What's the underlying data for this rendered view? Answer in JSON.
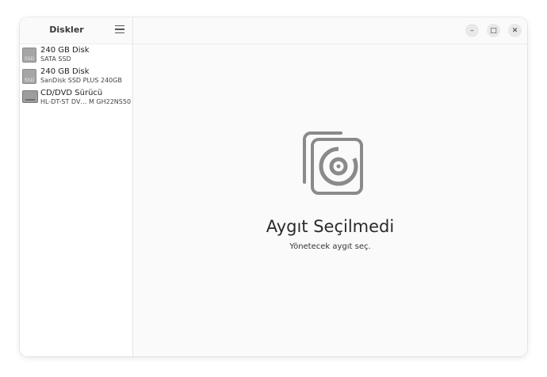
{
  "sidebar": {
    "title": "Diskler",
    "menu_icon": "hamburger-menu-icon",
    "items": [
      {
        "name": "240 GB Disk",
        "subtitle": "SATA SSD",
        "icon": "ssd-drive-icon",
        "icon_label": "SSD"
      },
      {
        "name": "240 GB Disk",
        "subtitle": "SanDisk SSD PLUS 240GB",
        "icon": "ssd-drive-icon",
        "icon_label": "SSD"
      },
      {
        "name": "CD/DVD Sürücü",
        "subtitle": "HL-DT-ST DV… M GH22NS50",
        "icon": "optical-drive-icon"
      }
    ]
  },
  "window_controls": {
    "minimize": "–",
    "maximize": "□",
    "close": "✕"
  },
  "empty_state": {
    "icon": "disk-placeholder-icon",
    "title": "Aygıt Seçilmedi",
    "subtitle": "Yönetecek aygıt seç."
  }
}
